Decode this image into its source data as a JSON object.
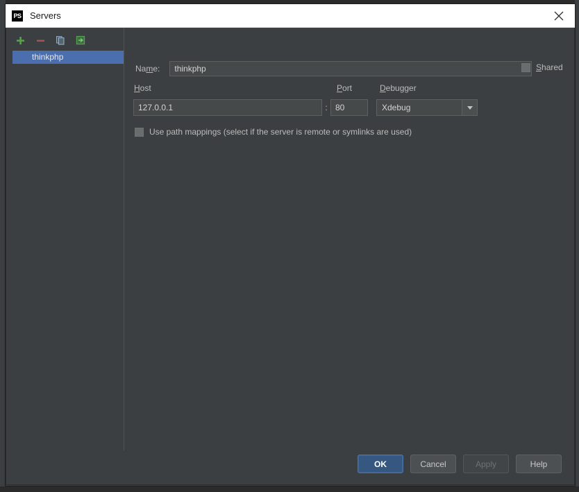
{
  "window": {
    "app_icon_text": "PS",
    "title": "Servers",
    "close_icon": "close-icon"
  },
  "sidebar": {
    "toolbar": [
      {
        "name": "add-server-button",
        "icon": "plus-icon",
        "color": "#5a9e41",
        "tooltip": "Add"
      },
      {
        "name": "remove-server-button",
        "icon": "minus-icon",
        "color": "#a65353",
        "tooltip": "Remove"
      },
      {
        "name": "copy-server-button",
        "icon": "copy-icon",
        "color": "#7a9bc4",
        "tooltip": "Copy"
      },
      {
        "name": "import-server-button",
        "icon": "import-arrow-icon",
        "color": "#4d9e4d",
        "tooltip": "Import"
      }
    ],
    "items": [
      {
        "label": "thinkphp",
        "selected": true
      }
    ]
  },
  "form": {
    "name_label": "Na",
    "name_label_mnemonic": "m",
    "name_label_rest": "e:",
    "name_value": "thinkphp",
    "shared_label_mnemonic": "S",
    "shared_label_rest": "hared",
    "shared_checked": false,
    "host_label_mnemonic": "H",
    "host_label_rest": "ost",
    "host_value": "127.0.0.1",
    "separator": ":",
    "port_label_mnemonic": "P",
    "port_label_rest": "ort",
    "port_value": "80",
    "debugger_label_mnemonic": "D",
    "debugger_label_rest": "ebugger",
    "debugger_value": "Xdebug",
    "debugger_options": [
      "Xdebug"
    ],
    "path_mappings_checked": false,
    "path_mappings_label": "Use path mappings (select if the server is remote or symlinks are used)"
  },
  "buttons": {
    "ok": "OK",
    "cancel": "Cancel",
    "apply": "Apply",
    "help": "Help",
    "apply_disabled": true
  },
  "colors": {
    "background": "#3c3f41",
    "selection": "#4b6eaf",
    "default_button": "#365880",
    "field_background": "#45494a",
    "titlebar": "#ffffff"
  }
}
